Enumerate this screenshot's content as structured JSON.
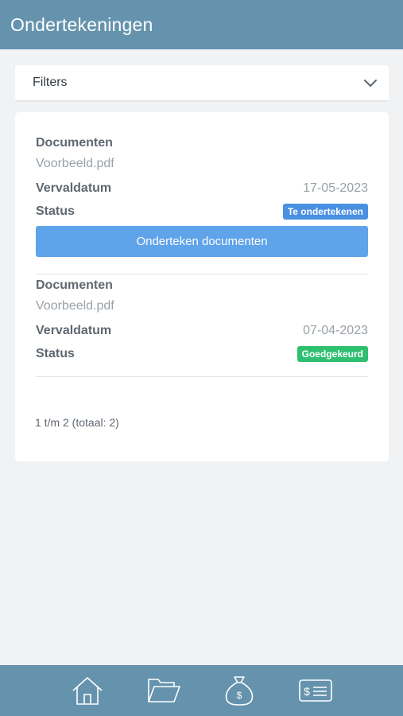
{
  "header": {
    "title": "Ondertekeningen"
  },
  "filters": {
    "label": "Filters",
    "icon": "chevron-down-icon"
  },
  "documents": [
    {
      "documents_label": "Documenten",
      "file": "Voorbeeld.pdf",
      "due_label": "Vervaldatum",
      "due_date": "17-05-2023",
      "status_label": "Status",
      "status": "Te ondertekenen",
      "status_color": "#4a90e2",
      "action_label": "Onderteken documenten"
    },
    {
      "documents_label": "Documenten",
      "file": "Voorbeeld.pdf",
      "due_label": "Vervaldatum",
      "due_date": "07-04-2023",
      "status_label": "Status",
      "status": "Goedgekeurd",
      "status_color": "#2fbf71"
    }
  ],
  "pagination": {
    "summary": "1 t/m 2 (totaal: 2)"
  },
  "bottom_nav": [
    {
      "icon": "home-icon"
    },
    {
      "icon": "folder-open-icon"
    },
    {
      "icon": "money-bag-icon"
    },
    {
      "icon": "bill-icon"
    }
  ],
  "colors": {
    "brand": "#6593ad",
    "button": "#5fa3ea",
    "background": "#f1f2f4"
  }
}
